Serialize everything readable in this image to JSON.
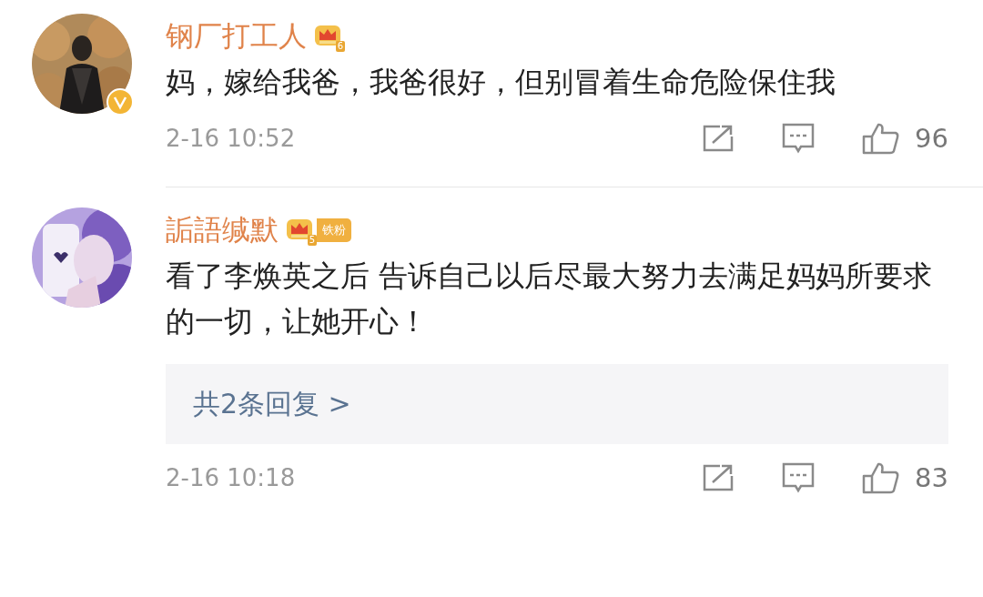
{
  "comments": [
    {
      "user": {
        "name": "钢厂打工人",
        "level": "6",
        "verified": true
      },
      "text": "妈，嫁给我爸，我爸很好，但别冒着生命危险保住我",
      "time": "2-16 10:52",
      "likes": "96"
    },
    {
      "user": {
        "name": "詬語缄默",
        "level": "5",
        "tag": "铁粉",
        "verified": false
      },
      "text": "看了李焕英之后 告诉自己以后尽最大努力去满足妈妈所要求的一切，让她开心！",
      "replies": "共2条回复 >",
      "time": "2-16 10:18",
      "likes": "83"
    }
  ]
}
